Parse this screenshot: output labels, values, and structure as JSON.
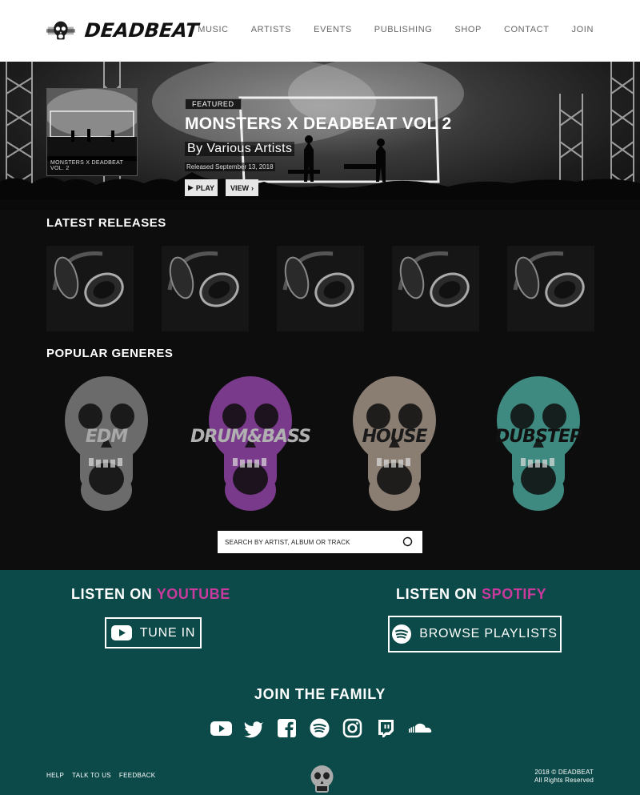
{
  "brand": {
    "name": "DEADBEAT"
  },
  "nav": [
    "MUSIC",
    "ARTISTS",
    "EVENTS",
    "PUBLISHING",
    "SHOP",
    "CONTACT",
    "JOIN"
  ],
  "hero": {
    "thumb_caption": "MONSTERS X DEADBEAT VOL. 2",
    "badge": "FEATURED",
    "title": "MONSTERS X DEADBEAT VOL 2",
    "artist": "By Various Artists",
    "release_date": "Released September 13, 2018",
    "play_label": "PLAY",
    "view_label": "VIEW"
  },
  "latest_releases": {
    "title": "LATEST RELEASES",
    "count": 5
  },
  "genres": {
    "title": "POPULAR GENERES",
    "items": [
      {
        "label": "EDM",
        "tint": "#6b6b6b",
        "text_color": "#a8a8a8"
      },
      {
        "label": "DRUM&BASS",
        "tint": "#7a3a8c",
        "text_color": "#b0b0b0"
      },
      {
        "label": "HOUSE",
        "tint": "#8a7d72",
        "text_color": "#1a1a1a"
      },
      {
        "label": "DUBSTEP",
        "tint": "#3f8a80",
        "text_color": "#111111"
      }
    ]
  },
  "search": {
    "placeholder": "SEARCH BY ARTIST, ALBUM OR TRACK"
  },
  "listen": {
    "youtube": {
      "prefix": "LISTEN ON",
      "service": "YOUTUBE",
      "button": "TUNE IN"
    },
    "spotify": {
      "prefix": "LISTEN ON",
      "service": "SPOTIFY",
      "button": "BROWSE PLAYLISTS"
    }
  },
  "join": {
    "title": "JOIN THE FAMILY"
  },
  "social_icons": [
    "youtube-icon",
    "twitter-icon",
    "facebook-icon",
    "spotify-icon",
    "instagram-icon",
    "twitch-icon",
    "soundcloud-icon"
  ],
  "footer": {
    "links": [
      "HELP",
      "TALK TO US",
      "FEEDBACK"
    ],
    "copyright": "2018 © DEADBEAT",
    "rights": "All Rights Reserved"
  },
  "colors": {
    "teal": "#0b4a48",
    "accent": "#c83a9d",
    "dark": "#0d0d0d"
  }
}
